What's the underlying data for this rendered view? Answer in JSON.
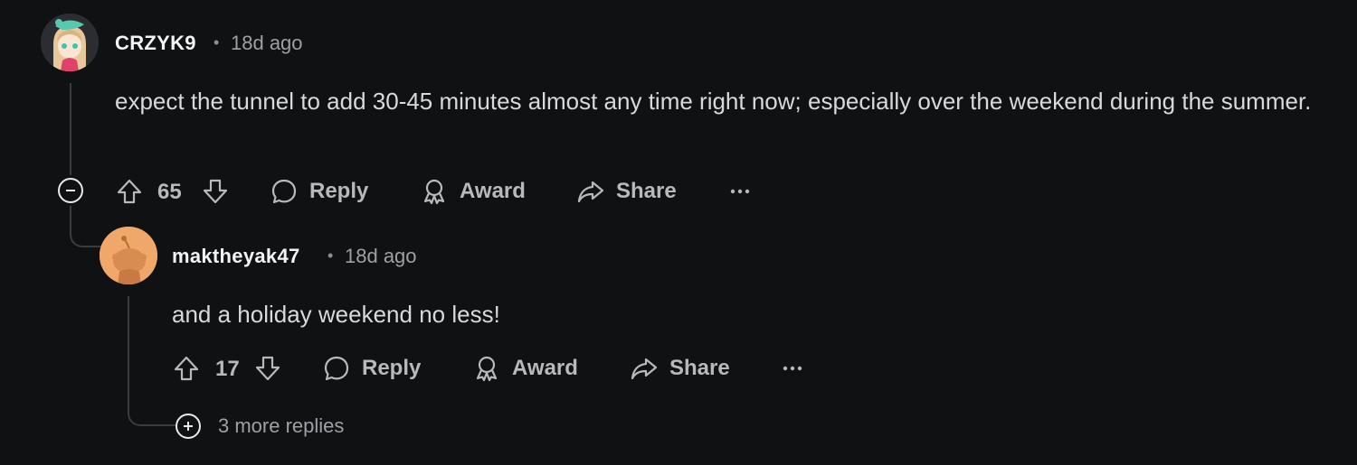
{
  "comment1": {
    "username": "CRZYK9",
    "separator": "•",
    "time": "18d ago",
    "body": "expect the tunnel to add 30-45 minutes almost any time right now; especially over the weekend during the summer.",
    "score": "65",
    "reply_label": "Reply",
    "award_label": "Award",
    "share_label": "Share"
  },
  "comment2": {
    "username": "maktheyak47",
    "separator": "•",
    "time": "18d ago",
    "body": "and a holiday weekend no less!",
    "score": "17",
    "reply_label": "Reply",
    "award_label": "Award",
    "share_label": "Share"
  },
  "more_replies": "3 more replies",
  "colors": {
    "background": "#0f1113",
    "thread_line": "#3a3d40",
    "avatar2_bg": "#f0a76a"
  },
  "icons": [
    "upvote-icon",
    "downvote-icon",
    "comment-icon",
    "award-icon",
    "share-icon",
    "more-icon",
    "collapse-icon",
    "expand-icon"
  ]
}
